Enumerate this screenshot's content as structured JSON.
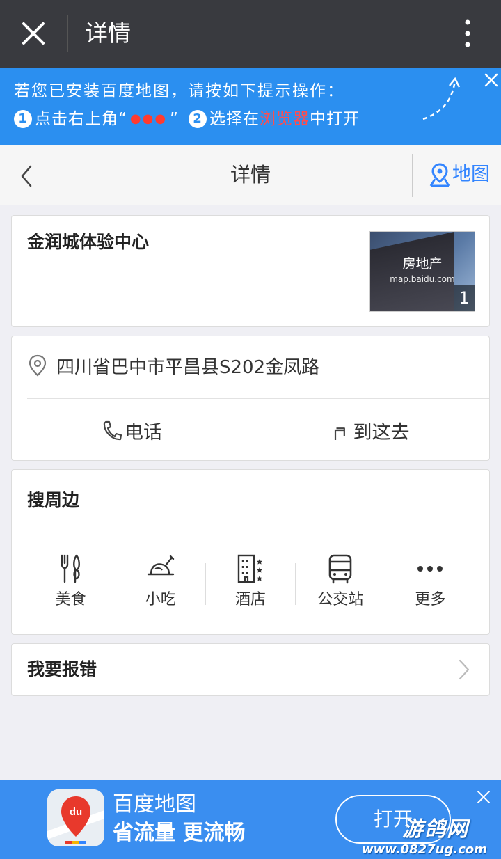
{
  "topbar": {
    "title": "详情"
  },
  "hint": {
    "line1": "若您已安装百度地图，请按如下提示操作：",
    "step1_num": "1",
    "step1_text": "点击右上角“",
    "step1_dots": "●●●",
    "step1_close": "”",
    "step2_num": "2",
    "step2_text": "选择在",
    "step2_browser": "浏览器",
    "step2_end": "中打开"
  },
  "header": {
    "title": "详情",
    "map_label": "地图"
  },
  "place": {
    "name": "金润城体验中心",
    "thumb_category": "房地产",
    "thumb_source": "map.baidu.com",
    "thumb_count": "1"
  },
  "address": {
    "text": "四川省巴中市平昌县S202金凤路",
    "phone_label": "电话",
    "go_label": "到这去"
  },
  "nearby": {
    "title": "搜周边",
    "items": [
      {
        "label": "美食",
        "icon": "fork-knife-icon"
      },
      {
        "label": "小吃",
        "icon": "snack-icon"
      },
      {
        "label": "酒店",
        "icon": "hotel-icon"
      },
      {
        "label": "公交站",
        "icon": "bus-icon"
      },
      {
        "label": "更多",
        "icon": "more-dots-icon"
      }
    ]
  },
  "report": {
    "label": "我要报错"
  },
  "promo": {
    "app_name": "百度地图",
    "slogan": "省流量 更流畅",
    "open_label": "打开",
    "watermark": "游鸽网",
    "watermark_url": "www.0827ug.com"
  },
  "colors": {
    "accent": "#3385ff",
    "banner": "#2b8ff0",
    "topbar": "#393a3f",
    "red": "#ff3b30"
  }
}
